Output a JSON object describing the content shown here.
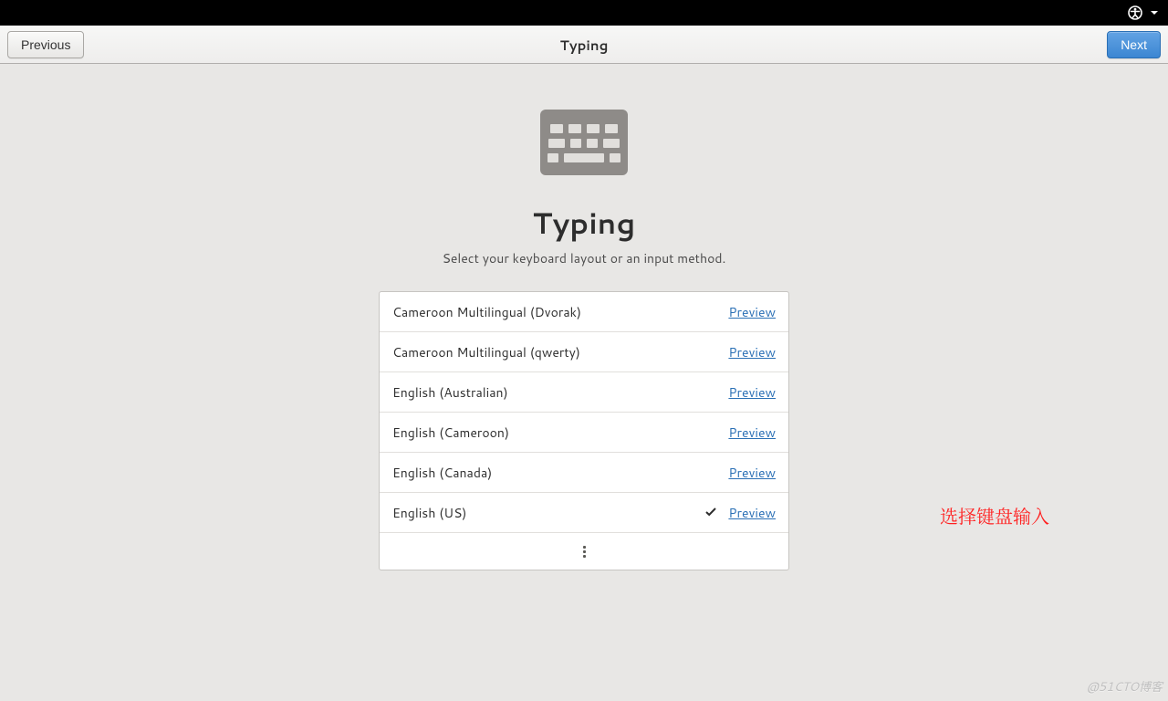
{
  "header": {
    "previous_label": "Previous",
    "title": "Typing",
    "next_label": "Next"
  },
  "page": {
    "title": "Typing",
    "subtitle": "Select your keyboard layout or an input method.",
    "preview_label": "Preview",
    "layouts": [
      {
        "name": "Cameroon Multilingual (Dvorak)",
        "selected": false
      },
      {
        "name": "Cameroon Multilingual (qwerty)",
        "selected": false
      },
      {
        "name": "English (Australian)",
        "selected": false
      },
      {
        "name": "English (Cameroon)",
        "selected": false
      },
      {
        "name": "English (Canada)",
        "selected": false
      },
      {
        "name": "English (US)",
        "selected": true
      }
    ]
  },
  "annotation": "选择键盘输入",
  "watermark": "@51CTO博客"
}
